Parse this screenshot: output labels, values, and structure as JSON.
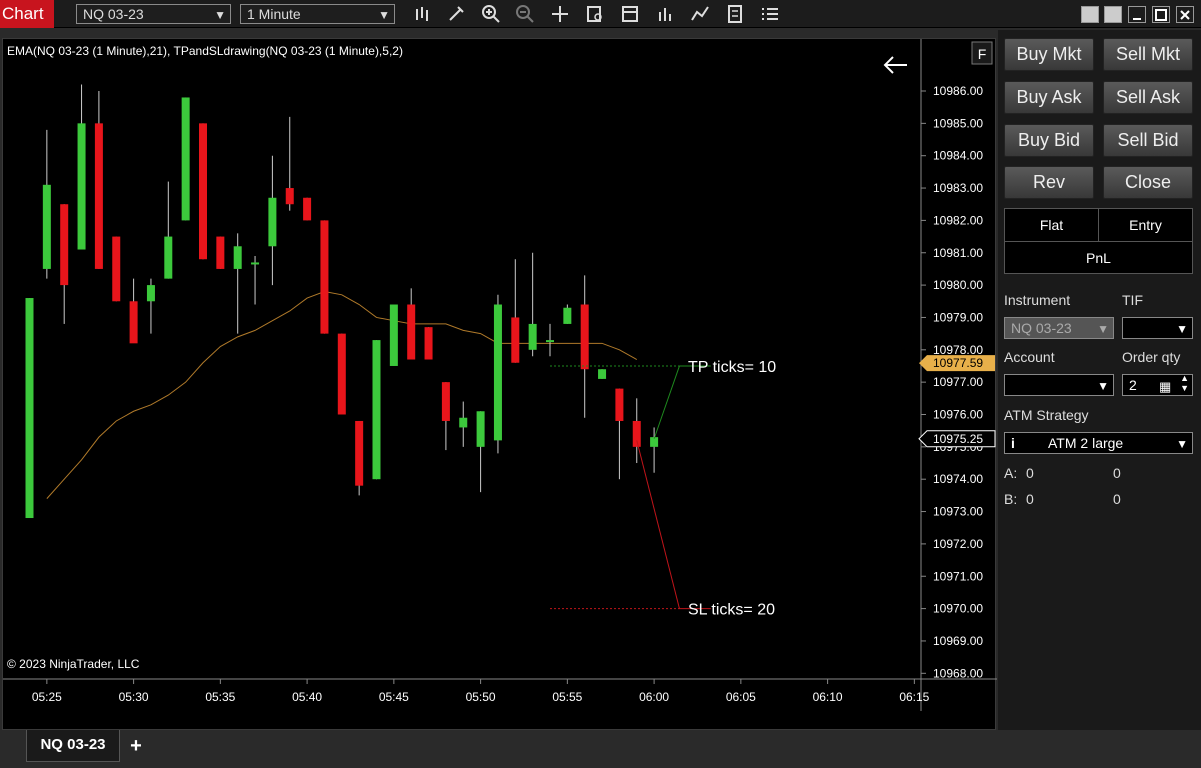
{
  "app": {
    "title": "Chart"
  },
  "toolbar": {
    "instrument": "NQ 03-23",
    "interval": "1 Minute"
  },
  "chart": {
    "indicator_label": "EMA(NQ 03-23 (1 Minute),21), TPandSLdrawing(NQ 03-23 (1 Minute),5,2)",
    "copyright": "© 2023 NinjaTrader, LLC",
    "f_button": "F",
    "tp_label": "TP ticks= 10",
    "sl_label": "SL ticks= 20",
    "price_labels": [
      "10986.00",
      "10985.00",
      "10984.00",
      "10983.00",
      "10982.00",
      "10981.00",
      "10980.00",
      "10979.00",
      "10978.00",
      "10977.00",
      "10976.00",
      "10975.00",
      "10974.00",
      "10973.00",
      "10972.00",
      "10971.00",
      "10970.00",
      "10969.00",
      "10968.00"
    ],
    "price_values": [
      10986,
      10985,
      10984,
      10983,
      10982,
      10981,
      10980,
      10979,
      10978,
      10977,
      10976,
      10975,
      10974,
      10973,
      10972,
      10971,
      10970,
      10969,
      10968
    ],
    "time_labels": [
      "05:25",
      "05:30",
      "05:35",
      "05:40",
      "05:45",
      "05:50",
      "05:55",
      "06:00",
      "06:05",
      "06:10",
      "06:15"
    ],
    "ask_marker": "10977.59",
    "last_marker": "10975.25",
    "colors": {
      "up": "#3cc93c",
      "down": "#e8151b",
      "ema": "#b07a2a",
      "tp": "#1e8a1e",
      "sl": "#c0141a",
      "ask_marker": "#e8b04a"
    }
  },
  "chart_data": {
    "type": "candlestick",
    "y_range": [
      10968,
      10986
    ],
    "x_ticks": [
      "05:25",
      "05:30",
      "05:35",
      "05:40",
      "05:45",
      "05:50",
      "05:55",
      "06:00",
      "06:05",
      "06:10",
      "06:15"
    ],
    "candles": [
      {
        "t": "05:24",
        "o": 10972.8,
        "h": 10979.6,
        "l": 10972.8,
        "c": 10979.6
      },
      {
        "t": "05:25",
        "o": 10980.5,
        "h": 10984.8,
        "l": 10980.2,
        "c": 10983.1
      },
      {
        "t": "05:26",
        "o": 10982.5,
        "h": 10982.5,
        "l": 10978.8,
        "c": 10980.0
      },
      {
        "t": "05:27",
        "o": 10981.1,
        "h": 10986.2,
        "l": 10981.1,
        "c": 10985.0
      },
      {
        "t": "05:28",
        "o": 10985.0,
        "h": 10986.0,
        "l": 10980.5,
        "c": 10980.5
      },
      {
        "t": "05:29",
        "o": 10981.5,
        "h": 10981.5,
        "l": 10979.5,
        "c": 10979.5
      },
      {
        "t": "05:30",
        "o": 10979.5,
        "h": 10980.2,
        "l": 10978.3,
        "c": 10978.2
      },
      {
        "t": "05:31",
        "o": 10979.5,
        "h": 10980.2,
        "l": 10978.5,
        "c": 10980.0
      },
      {
        "t": "05:32",
        "o": 10980.2,
        "h": 10983.2,
        "l": 10980.2,
        "c": 10981.5
      },
      {
        "t": "05:33",
        "o": 10982.0,
        "h": 10985.8,
        "l": 10982.0,
        "c": 10985.8
      },
      {
        "t": "05:34",
        "o": 10985.0,
        "h": 10985.0,
        "l": 10980.8,
        "c": 10980.8
      },
      {
        "t": "05:35",
        "o": 10981.5,
        "h": 10981.5,
        "l": 10980.5,
        "c": 10980.5
      },
      {
        "t": "05:36",
        "o": 10980.5,
        "h": 10981.6,
        "l": 10978.5,
        "c": 10981.2
      },
      {
        "t": "05:37",
        "o": 10980.7,
        "h": 10980.9,
        "l": 10979.4,
        "c": 10980.7
      },
      {
        "t": "05:38",
        "o": 10981.2,
        "h": 10984.0,
        "l": 10980.0,
        "c": 10982.7
      },
      {
        "t": "05:39",
        "o": 10983.0,
        "h": 10985.2,
        "l": 10982.3,
        "c": 10982.5
      },
      {
        "t": "05:40",
        "o": 10982.7,
        "h": 10982.7,
        "l": 10982.0,
        "c": 10982.0
      },
      {
        "t": "05:41",
        "o": 10982.0,
        "h": 10982.0,
        "l": 10978.5,
        "c": 10978.5
      },
      {
        "t": "05:42",
        "o": 10978.5,
        "h": 10978.5,
        "l": 10976.0,
        "c": 10976.0
      },
      {
        "t": "05:43",
        "o": 10975.8,
        "h": 10975.8,
        "l": 10973.5,
        "c": 10973.8
      },
      {
        "t": "05:44",
        "o": 10974.0,
        "h": 10978.3,
        "l": 10974.0,
        "c": 10978.3
      },
      {
        "t": "05:45",
        "o": 10977.5,
        "h": 10979.4,
        "l": 10977.5,
        "c": 10979.4
      },
      {
        "t": "05:46",
        "o": 10979.4,
        "h": 10979.9,
        "l": 10977.7,
        "c": 10977.7
      },
      {
        "t": "05:47",
        "o": 10978.7,
        "h": 10978.7,
        "l": 10977.7,
        "c": 10977.7
      },
      {
        "t": "05:48",
        "o": 10977.0,
        "h": 10977.0,
        "l": 10974.9,
        "c": 10975.8
      },
      {
        "t": "05:49",
        "o": 10975.6,
        "h": 10976.4,
        "l": 10975.0,
        "c": 10975.9
      },
      {
        "t": "05:50",
        "o": 10975.0,
        "h": 10976.1,
        "l": 10973.6,
        "c": 10976.1
      },
      {
        "t": "05:51",
        "o": 10975.2,
        "h": 10979.7,
        "l": 10974.8,
        "c": 10979.4
      },
      {
        "t": "05:52",
        "o": 10979.0,
        "h": 10980.8,
        "l": 10977.6,
        "c": 10977.6
      },
      {
        "t": "05:53",
        "o": 10978.0,
        "h": 10981.0,
        "l": 10977.8,
        "c": 10978.8
      },
      {
        "t": "05:54",
        "o": 10978.3,
        "h": 10978.8,
        "l": 10977.8,
        "c": 10978.3
      },
      {
        "t": "05:55",
        "o": 10978.8,
        "h": 10979.4,
        "l": 10978.8,
        "c": 10979.3
      },
      {
        "t": "05:56",
        "o": 10979.4,
        "h": 10980.3,
        "l": 10975.9,
        "c": 10977.4
      },
      {
        "t": "05:57",
        "o": 10977.1,
        "h": 10977.4,
        "l": 10977.1,
        "c": 10977.4
      },
      {
        "t": "05:58",
        "o": 10976.8,
        "h": 10976.8,
        "l": 10974.0,
        "c": 10975.8
      },
      {
        "t": "05:59",
        "o": 10975.8,
        "h": 10976.5,
        "l": 10974.5,
        "c": 10975.0
      },
      {
        "t": "06:00",
        "o": 10975.0,
        "h": 10975.6,
        "l": 10974.2,
        "c": 10975.3
      }
    ],
    "ema": {
      "name": "EMA(NQ 03-23 (1 Minute),21)",
      "values": [
        10973.4,
        10974.0,
        10974.6,
        10975.3,
        10975.8,
        10976.1,
        10976.3,
        10976.6,
        10977.0,
        10977.6,
        10978.1,
        10978.4,
        10978.6,
        10978.9,
        10979.2,
        10979.6,
        10979.8,
        10979.7,
        10979.4,
        10979.0,
        10978.9,
        10978.8,
        10978.8,
        10978.8,
        10978.6,
        10978.5,
        10978.2,
        10978.2,
        10978.2,
        10978.2,
        10978.2,
        10978.2,
        10978.2,
        10978.0,
        10977.7
      ]
    },
    "tp_level": 10977.5,
    "sl_level": 10970.0,
    "annotations": [
      "TP ticks= 10",
      "SL ticks= 20"
    ],
    "ask_marker": 10977.59,
    "last_marker": 10975.25,
    "grid": false
  },
  "orders": {
    "buy_mkt": "Buy Mkt",
    "sell_mkt": "Sell Mkt",
    "buy_ask": "Buy Ask",
    "sell_ask": "Sell Ask",
    "buy_bid": "Buy Bid",
    "sell_bid": "Sell Bid",
    "rev": "Rev",
    "close": "Close",
    "flat": "Flat",
    "entry": "Entry",
    "pnl": "PnL",
    "instrument_label": "Instrument",
    "tif_label": "TIF",
    "instrument_value": "NQ 03-23",
    "account_label": "Account",
    "order_qty_label": "Order qty",
    "order_qty_value": "2",
    "atm_label": "ATM Strategy",
    "atm_value": "ATM 2  large",
    "a_label": "A:",
    "a_val1": "0",
    "a_val2": "0",
    "b_label": "B:",
    "b_val1": "0",
    "b_val2": "0"
  },
  "tabs": {
    "active": "NQ 03-23",
    "add": "+"
  }
}
